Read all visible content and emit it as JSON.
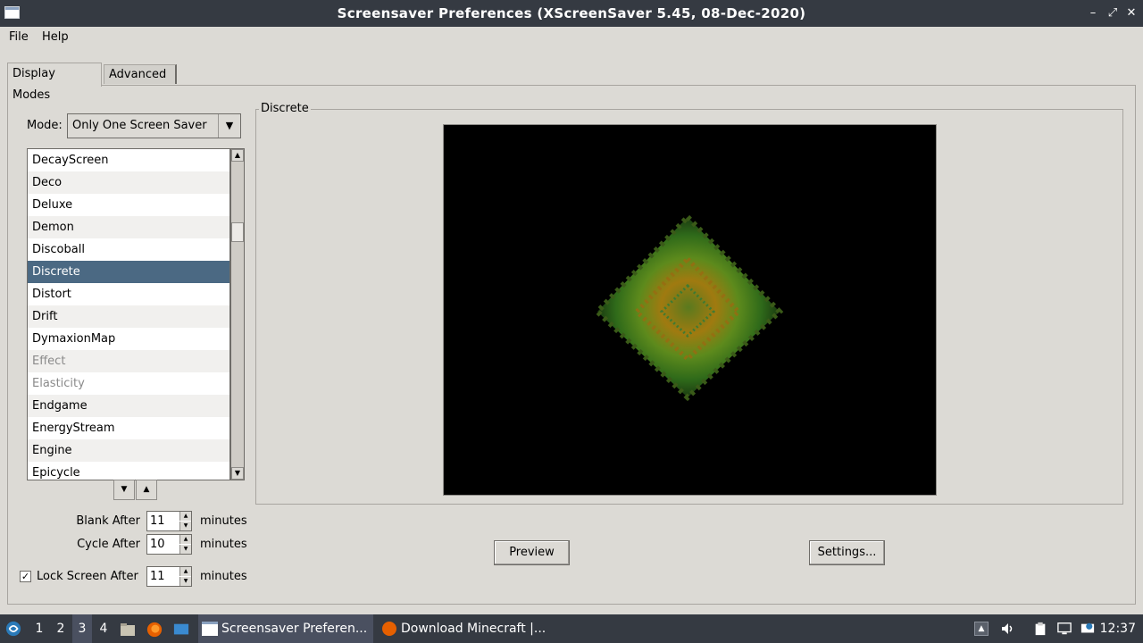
{
  "window": {
    "title": "Screensaver Preferences  (XScreenSaver 5.45, 08-Dec-2020)",
    "minimize_glyph": "–",
    "maximize_glyph": "⤢",
    "close_glyph": "✕"
  },
  "menu": {
    "file": "File",
    "help": "Help"
  },
  "tabs": [
    {
      "label": "Display Modes",
      "active": true
    },
    {
      "label": "Advanced",
      "active": false
    }
  ],
  "mode": {
    "label": "Mode:",
    "value": "Only One Screen Saver"
  },
  "list": {
    "items": [
      {
        "label": "DecayScreen",
        "state": "normal"
      },
      {
        "label": "Deco",
        "state": "normal"
      },
      {
        "label": "Deluxe",
        "state": "normal"
      },
      {
        "label": "Demon",
        "state": "normal"
      },
      {
        "label": "Discoball",
        "state": "normal"
      },
      {
        "label": "Discrete",
        "state": "selected"
      },
      {
        "label": "Distort",
        "state": "normal"
      },
      {
        "label": "Drift",
        "state": "normal"
      },
      {
        "label": "DymaxionMap",
        "state": "normal"
      },
      {
        "label": "Effect",
        "state": "disabled"
      },
      {
        "label": "Elasticity",
        "state": "disabled"
      },
      {
        "label": "Endgame",
        "state": "normal"
      },
      {
        "label": "EnergyStream",
        "state": "normal"
      },
      {
        "label": "Engine",
        "state": "normal"
      },
      {
        "label": "Epicycle",
        "state": "normal"
      }
    ]
  },
  "settings": {
    "blank_after_label": "Blank After",
    "blank_after_value": "11",
    "cycle_after_label": "Cycle After",
    "cycle_after_value": "10",
    "lock_label": "Lock Screen After",
    "lock_value": "11",
    "lock_checked": true,
    "unit": "minutes"
  },
  "preview_group": {
    "title": "Discrete",
    "preview_button": "Preview",
    "settings_button": "Settings..."
  },
  "taskbar": {
    "workspaces": [
      "1",
      "2",
      "3",
      "4"
    ],
    "active_workspace": "3",
    "tasks": [
      {
        "label": "Screensaver Preferen...",
        "active": true
      },
      {
        "label": "Download Minecraft |...",
        "active": false
      }
    ],
    "clock": "12:37"
  },
  "colors": {
    "selection": "#4b6983",
    "titlebar": "#353a42",
    "window_bg": "#dcdad5"
  }
}
